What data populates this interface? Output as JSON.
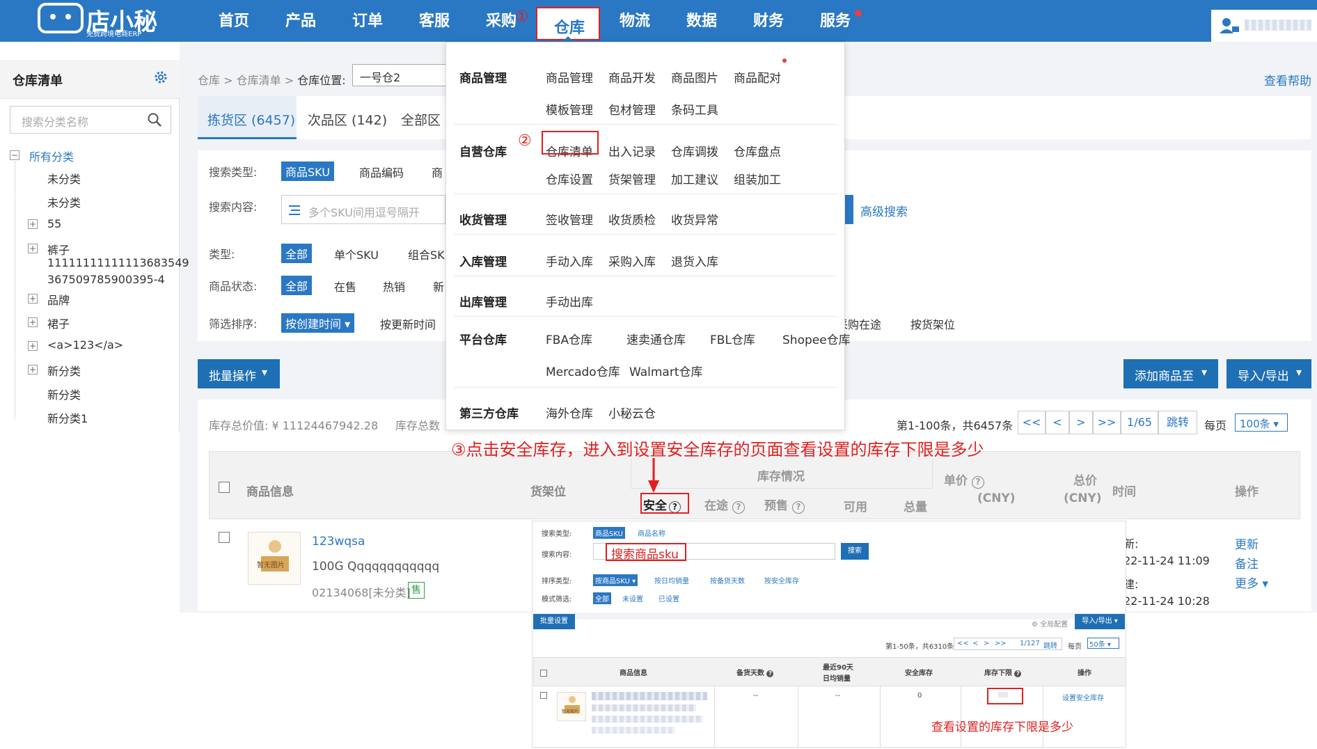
{
  "logo": {
    "title": "店小秘",
    "subtitle": "免费跨境电商ERP"
  },
  "nav": {
    "items": [
      "首页",
      "产品",
      "订单",
      "客服",
      "采购",
      "仓库",
      "物流",
      "数据",
      "财务",
      "服务"
    ],
    "step1": "①"
  },
  "sidebar": {
    "title": "仓库清单",
    "search_placeholder": "搜索分类名称",
    "root": "所有分类",
    "items": [
      "未分类",
      "未分类",
      "55",
      "裤子",
      "11111111111113683549",
      "367509785900395-4",
      "品牌",
      "裙子",
      "<a>123</a>",
      "新分类",
      "新分类",
      "新分类1"
    ],
    "minus": "−",
    "plus": "+"
  },
  "breadcrumb": {
    "a": "仓库",
    "b": "仓库清单",
    "c": "仓库位置:",
    "sep": ">",
    "wh": "一号仓2",
    "help": "查看帮助"
  },
  "tabs": [
    "拣货区 (6457)",
    "次品区 (142)",
    "全部区 ("
  ],
  "filters": {
    "type_label": "搜索类型:",
    "sku": "商品SKU",
    "code": "商品编码",
    "more": "商",
    "content_label": "搜索内容:",
    "content_placeholder": "多个SKU间用逗号隔开",
    "advanced": "高级搜索",
    "kind_label": "类型:",
    "all": "全部",
    "single": "单个SKU",
    "combo": "组合SK",
    "status_label": "商品状态:",
    "on_sale": "在售",
    "hot": "热销",
    "new": "新",
    "sort_label": "筛选排序:",
    "by_create": "按创建时间",
    "by_update": "按更新时间",
    "purchase_transit": "采购在途",
    "by_shelf": "按货架位"
  },
  "actions": {
    "batch": "批量操作",
    "add_to": "添加商品至",
    "import_export": "导入/导出"
  },
  "summary": {
    "total_value": "库存总价值: ¥ 11124467942.28",
    "total_qty": "库存总数",
    "range": "第1-100条，共6457条",
    "page": "1/65",
    "jump": "跳转",
    "per_page": "每页",
    "per_value": "100条",
    "first": "<<",
    "prev": "<",
    "next": ">",
    "last": ">>"
  },
  "table": {
    "product_info": "商品信息",
    "shelf": "货架位",
    "stock": "库存情况",
    "safe": "安全",
    "transit": "在途",
    "presale": "预售",
    "available": "可用",
    "total": "总量",
    "unit_price": "单价",
    "unit_cny": "(CNY)",
    "total_price": "总价",
    "total_cny": "(CNY)",
    "time": "时间",
    "ops": "操作",
    "help": "?"
  },
  "row": {
    "no_image": "暂无图片",
    "name": "123wqsa",
    "spec": "100G Qqqqqqqqqqqq",
    "code": "02134068[未分类]",
    "badge": "售",
    "update_lbl": "新:",
    "update_time": "22-11-24 11:09",
    "create_lbl": "建:",
    "create_time": "22-11-24 10:28",
    "op_update": "更新",
    "op_note": "备注",
    "op_more": "更多"
  },
  "dropdown": {
    "step2": "②",
    "groups": [
      {
        "title": "商品管理",
        "rows": [
          [
            "商品管理",
            "商品开发",
            "商品图片",
            "商品配对"
          ],
          [
            "模板管理",
            "包材管理",
            "条码工具"
          ]
        ]
      },
      {
        "title": "自营仓库",
        "rows": [
          [
            "仓库清单",
            "出入记录",
            "仓库调拨",
            "仓库盘点"
          ],
          [
            "仓库设置",
            "货架管理",
            "加工建议",
            "组装加工"
          ]
        ]
      },
      {
        "title": "收货管理",
        "rows": [
          [
            "签收管理",
            "收货质检",
            "收货异常"
          ]
        ]
      },
      {
        "title": "入库管理",
        "rows": [
          [
            "手动入库",
            "采购入库",
            "退货入库"
          ]
        ]
      },
      {
        "title": "出库管理",
        "rows": [
          [
            "手动出库"
          ]
        ]
      },
      {
        "title": "平台仓库",
        "rows": [
          [
            "FBA仓库",
            "速卖通仓库",
            "FBL仓库",
            "Shopee仓库"
          ],
          [
            "Mercado仓库",
            "Walmart仓库"
          ]
        ]
      },
      {
        "title": "第三方仓库",
        "rows": [
          [
            "海外仓库",
            "小秘云仓"
          ]
        ]
      }
    ]
  },
  "annotation": {
    "step3": "③点击安全库存，进入到设置安全库存的页面查看设置的库存下限是多少",
    "note": "查看设置的库存下限是多少"
  },
  "embedded": {
    "type_label": "搜索类型:",
    "sku": "商品SKU",
    "name": "商品名称",
    "content_label": "搜索内容:",
    "content_hint": "搜索商品sku",
    "search": "搜索",
    "sort_label": "排序类型:",
    "sort_sku": "按商品SKU",
    "sort_daily": "按日均销量",
    "sort_days": "按备货天数",
    "sort_safe": "按安全库存",
    "mode_label": "模式筛选:",
    "all": "全部",
    "unset": "未设置",
    "set": "已设置",
    "batch": "批量设置",
    "global": "全局配置",
    "import_export": "导入/导出",
    "range": "第1-50条，共6310条",
    "page": "1/127",
    "jump": "跳转",
    "per_page": "每页",
    "per_value": "50条",
    "first": "<<",
    "prev": "<",
    "next": ">",
    "last": ">>",
    "h_info": "商品信息",
    "h_days": "备货天数",
    "h_sales1": "最近90天",
    "h_sales2": "日均销量",
    "h_safe": "安全库存",
    "h_min": "库存下限",
    "h_ops": "操作",
    "dash": "--",
    "zero": "0",
    "set_safe": "设置安全库存",
    "no_image": "暂无图片",
    "help": "?"
  }
}
